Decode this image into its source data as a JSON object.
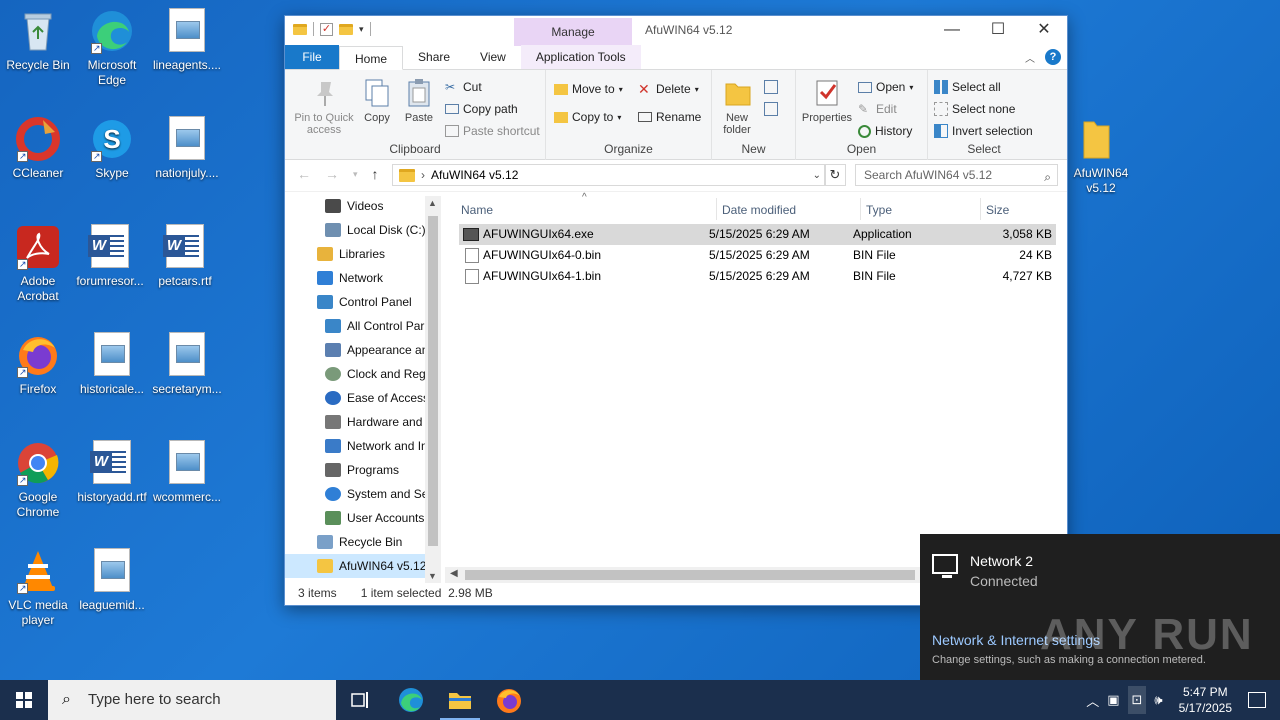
{
  "desktop": {
    "icons": [
      {
        "label": "Recycle Bin"
      },
      {
        "label": "Microsoft Edge"
      },
      {
        "label": "lineagents...."
      },
      {
        "label": "CCleaner"
      },
      {
        "label": "Skype"
      },
      {
        "label": "nationjuly...."
      },
      {
        "label": "Adobe Acrobat"
      },
      {
        "label": "forumresor..."
      },
      {
        "label": "petcars.rtf"
      },
      {
        "label": "Firefox"
      },
      {
        "label": "historicale..."
      },
      {
        "label": "secretarym..."
      },
      {
        "label": "Google Chrome"
      },
      {
        "label": "historyadd.rtf"
      },
      {
        "label": "wcommerc..."
      },
      {
        "label": "VLC media player"
      },
      {
        "label": "leaguemid..."
      },
      {
        "label": "AfuWIN64 v5.12"
      }
    ]
  },
  "window": {
    "title": "AfuWIN64 v5.12",
    "manage_tab": "Manage",
    "tabs": {
      "file": "File",
      "home": "Home",
      "share": "Share",
      "view": "View",
      "app_tools": "Application Tools"
    },
    "ribbon": {
      "clipboard": {
        "label": "Clipboard",
        "pin": "Pin to Quick access",
        "copy": "Copy",
        "paste": "Paste",
        "cut": "Cut",
        "copy_path": "Copy path",
        "paste_shortcut": "Paste shortcut"
      },
      "organize": {
        "label": "Organize",
        "move_to": "Move to",
        "copy_to": "Copy to",
        "delete": "Delete",
        "rename": "Rename"
      },
      "new": {
        "label": "New",
        "new_folder": "New folder"
      },
      "open": {
        "label": "Open",
        "properties": "Properties",
        "open": "Open",
        "edit": "Edit",
        "history": "History"
      },
      "select": {
        "label": "Select",
        "select_all": "Select all",
        "select_none": "Select none",
        "invert": "Invert selection"
      }
    },
    "address": {
      "path": "AfuWIN64 v5.12"
    },
    "search": {
      "placeholder": "Search AfuWIN64 v5.12"
    },
    "nav_pane": [
      {
        "label": "Videos",
        "color": "#4a4a4a"
      },
      {
        "label": "Local Disk (C:)",
        "color": "#6f8fb0"
      },
      {
        "label": "Libraries",
        "color": "#e8b33c"
      },
      {
        "label": "Network",
        "color": "#2f7fd6"
      },
      {
        "label": "Control Panel",
        "color": "#3a86c8"
      },
      {
        "label": "All Control Par",
        "color": "#3a86c8"
      },
      {
        "label": "Appearance an",
        "color": "#5b7fb0"
      },
      {
        "label": "Clock and Regi",
        "color": "#7a9a7a"
      },
      {
        "label": "Ease of Access",
        "color": "#2a6bc2"
      },
      {
        "label": "Hardware and",
        "color": "#777777"
      },
      {
        "label": "Network and In",
        "color": "#3a7bc8"
      },
      {
        "label": "Programs",
        "color": "#666666"
      },
      {
        "label": "System and Sec",
        "color": "#2f7fd6"
      },
      {
        "label": "User Accounts",
        "color": "#5a8f5a"
      },
      {
        "label": "Recycle Bin",
        "color": "#7aa0c8"
      },
      {
        "label": "AfuWIN64 v5.12",
        "color": "#f4c542"
      }
    ],
    "columns": {
      "name": "Name",
      "date": "Date modified",
      "type": "Type",
      "size": "Size"
    },
    "files": [
      {
        "name": "AFUWINGUIx64.exe",
        "date": "5/15/2025 6:29 AM",
        "type": "Application",
        "size": "3,058 KB"
      },
      {
        "name": "AFUWINGUIx64-0.bin",
        "date": "5/15/2025 6:29 AM",
        "type": "BIN File",
        "size": "24 KB"
      },
      {
        "name": "AFUWINGUIx64-1.bin",
        "date": "5/15/2025 6:29 AM",
        "type": "BIN File",
        "size": "4,727 KB"
      }
    ],
    "status": {
      "count": "3 items",
      "selected": "1 item selected",
      "size": "2.98 MB"
    }
  },
  "network_flyout": {
    "name": "Network 2",
    "status": "Connected",
    "settings_link": "Network & Internet settings",
    "settings_desc": "Change settings, such as making a connection metered.",
    "watermark": "ANY RUN"
  },
  "taskbar": {
    "search_placeholder": "Type here to search",
    "time": "5:47 PM",
    "date": "5/17/2025"
  }
}
